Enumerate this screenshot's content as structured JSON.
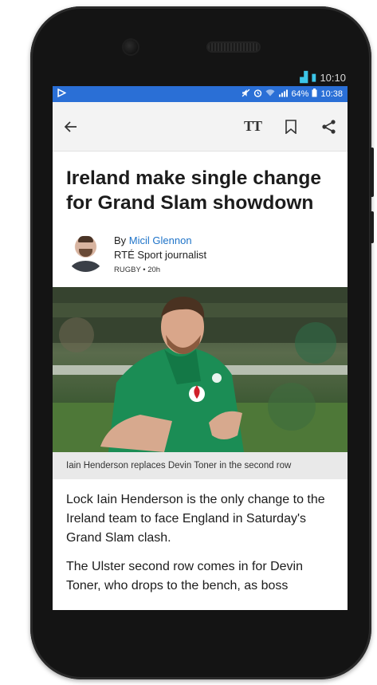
{
  "device": {
    "outer_status": {
      "time": "10:10"
    }
  },
  "status_bar": {
    "left_icon": "play-store-icon",
    "battery": "64%",
    "time": "10:38"
  },
  "toolbar": {
    "back_icon": "back-arrow-icon",
    "text_size_label": "TT",
    "bookmark_icon": "bookmark-icon",
    "share_icon": "share-icon"
  },
  "article": {
    "headline": "Ireland make single change for Grand Slam showdown",
    "byline_prefix": "By ",
    "author": "Micil Glennon",
    "author_role": "RTÉ Sport journalist",
    "section": "RUGBY",
    "age": "20h",
    "meta": "RUGBY • 20h",
    "photo_caption": "Iain Henderson replaces Devin Toner in the second row",
    "paragraphs": [
      "Lock Iain Henderson is the only change to the Ireland team to face England in Saturday's Grand Slam clash.",
      "The Ulster second row comes in for Devin Toner, who drops to the bench, as boss"
    ]
  },
  "colors": {
    "status_bar": "#2a6fd6",
    "link": "#1e73c8",
    "toolbar": "#f3f3f3",
    "caption_bg": "#e9e9e9"
  }
}
